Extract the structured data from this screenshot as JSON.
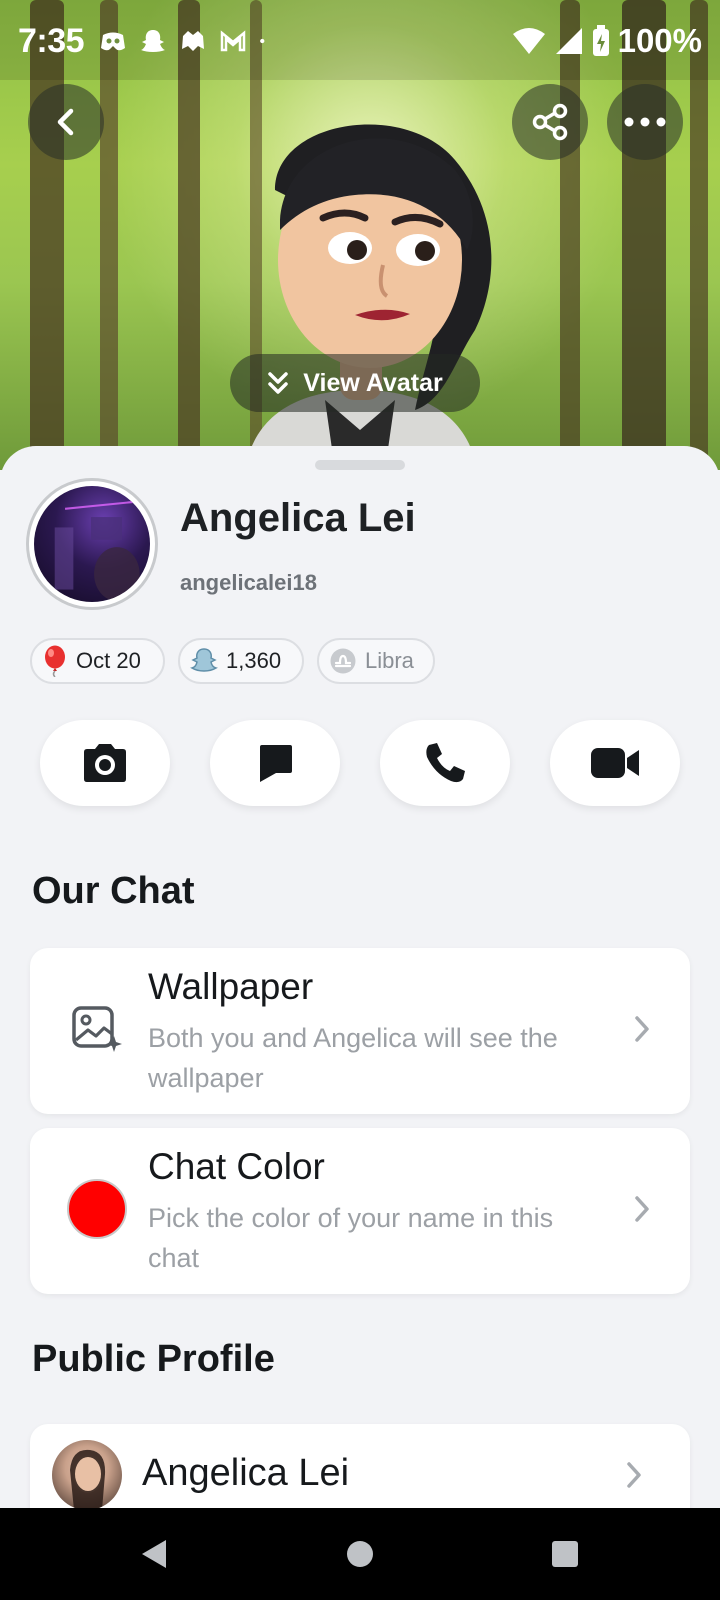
{
  "status_bar": {
    "time": "7:35",
    "battery": "100%",
    "left_icons": [
      "discord-icon",
      "snapchat-icon",
      "game-icon",
      "gmail-icon",
      "dot-icon"
    ],
    "right_icons": [
      "wifi-icon",
      "signal-icon",
      "battery-icon"
    ]
  },
  "header": {
    "view_avatar_label": "View Avatar",
    "buttons": [
      "back-icon",
      "share-icon",
      "more-icon"
    ]
  },
  "profile": {
    "display_name": "Angelica Lei",
    "username": "angelicalei18",
    "chips": {
      "birthday": "Oct 20",
      "score": "1,360",
      "zodiac": "Libra"
    }
  },
  "actions": [
    "camera-icon",
    "chat-icon",
    "phone-icon",
    "video-icon"
  ],
  "our_chat": {
    "title": "Our Chat",
    "wallpaper": {
      "title": "Wallpaper",
      "description": "Both you and Angelica will see the wallpaper"
    },
    "chat_color": {
      "title": "Chat Color",
      "description": "Pick the color of your name in this chat",
      "color": "#ff0000"
    }
  },
  "public_profile": {
    "title": "Public Profile",
    "name": "Angelica Lei"
  },
  "colors": {
    "sheet_bg": "#f2f3f6",
    "text_primary": "#16191c",
    "text_secondary": "#9ca0a5",
    "accent_red": "#ff0000"
  }
}
